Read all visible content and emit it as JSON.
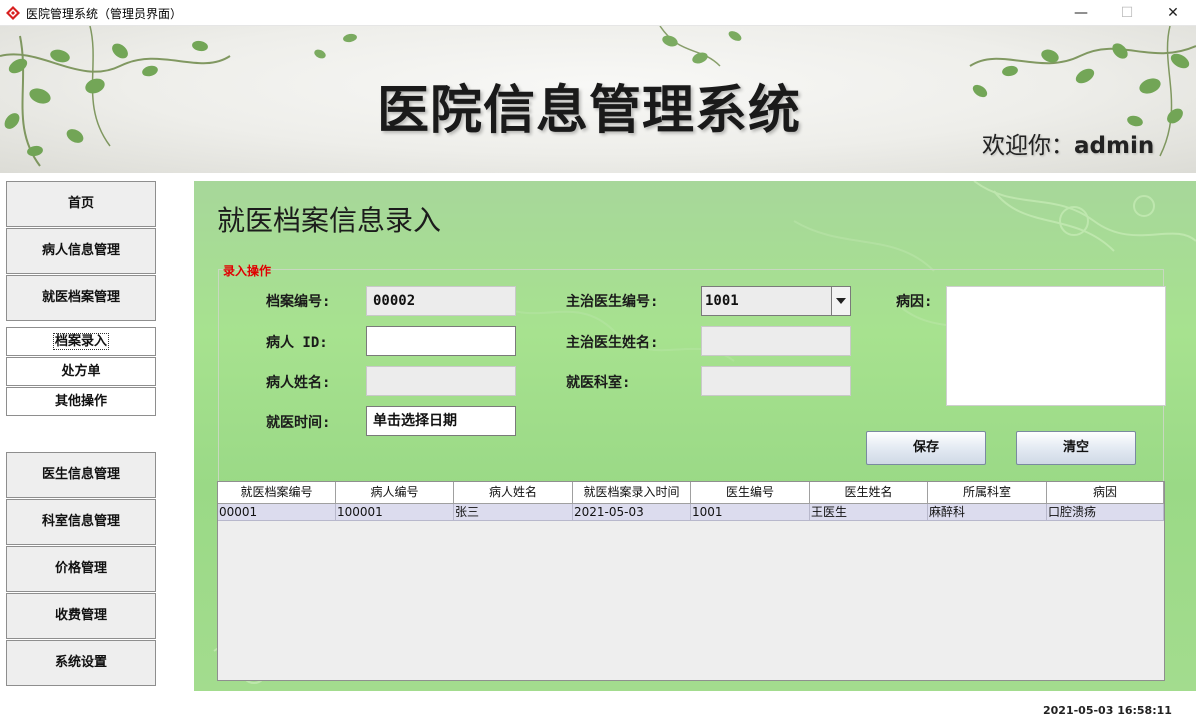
{
  "window": {
    "title": "医院管理系统（管理员界面）",
    "minimize": "—",
    "maximize": "☐",
    "close": "✕"
  },
  "banner": {
    "title": "医院信息管理系统",
    "welcome_label": "欢迎你：",
    "username": "admin"
  },
  "nav": {
    "top_items": [
      "首页",
      "病人信息管理",
      "就医档案管理"
    ],
    "sub_items": [
      "档案录入",
      "处方单",
      "其他操作"
    ],
    "bottom_items": [
      "医生信息管理",
      "科室信息管理",
      "价格管理",
      "收费管理",
      "系统设置"
    ]
  },
  "main": {
    "title": "就医档案信息录入",
    "group_legend": "录入操作",
    "fields": {
      "record_no_label": "档案编号:",
      "record_no_value": "00002",
      "patient_id_label": "病人 ID:",
      "patient_id_value": "",
      "patient_name_label": "病人姓名:",
      "patient_name_value": "",
      "visit_time_label": "就医时间:",
      "visit_time_value": "单击选择日期",
      "doctor_no_label": "主治医生编号:",
      "doctor_no_value": "1001",
      "doctor_name_label": "主治医生姓名:",
      "doctor_name_value": "",
      "department_label": "就医科室:",
      "department_value": "",
      "cause_label": "病因:",
      "cause_value": ""
    },
    "buttons": {
      "save": "保存",
      "clear": "清空"
    }
  },
  "table": {
    "columns": [
      "就医档案编号",
      "病人编号",
      "病人姓名",
      "就医档案录入时间",
      "医生编号",
      "医生姓名",
      "所属科室",
      "病因"
    ],
    "rows": [
      [
        "00001",
        "100001",
        "张三",
        "2021-05-03",
        "1001",
        "王医生",
        "麻醉科",
        "口腔溃疡"
      ]
    ]
  },
  "status": {
    "clock": "2021-05-03 16:58:11"
  },
  "colors": {
    "legend_red": "#e00000",
    "panel_green": "#a7e28f",
    "row_highlight": "#dcdcee"
  },
  "icons": [
    "app-diamond-icon",
    "minimize-icon",
    "maximize-icon",
    "close-icon",
    "dropdown-arrow-icon"
  ]
}
